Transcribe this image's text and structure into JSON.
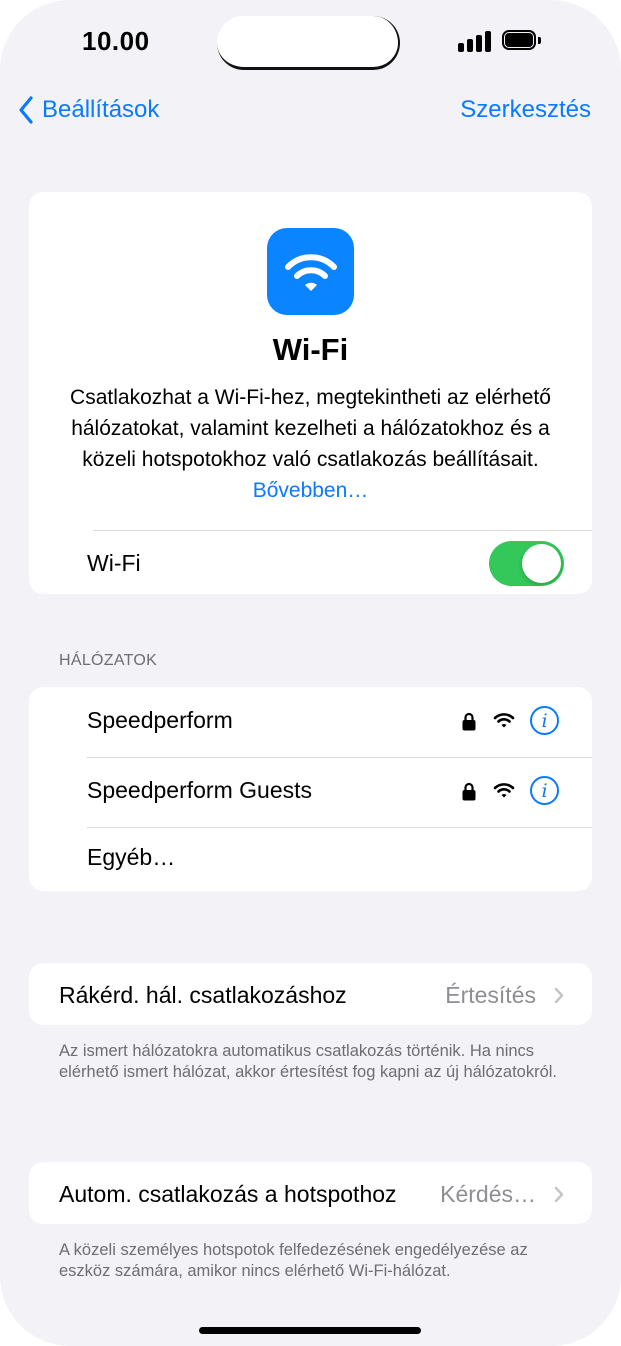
{
  "status_bar": {
    "time": "10.00"
  },
  "nav": {
    "back_label": "Beállítások",
    "edit_label": "Szerkesztés"
  },
  "hero": {
    "title": "Wi-Fi",
    "description": "Csatlakozhat a Wi-Fi-hez, megtekintheti az elérhető hálózatokat, valamint kezelheti a hálózatokhoz és a közeli hotspotokhoz való csatlakozás beállításait.",
    "link_label": "Bővebben…",
    "wifi_label": "Wi-Fi",
    "wifi_enabled": true
  },
  "networks": {
    "header": "HÁLÓZATOK",
    "items": [
      {
        "name": "Speedperform",
        "locked": true,
        "info_icon": "info-icon"
      },
      {
        "name": "Speedperform Guests",
        "locked": true,
        "info_icon": "info-icon"
      }
    ],
    "other_label": "Egyéb…"
  },
  "ask_join": {
    "label": "Rákérd. hál. csatlakozáshoz",
    "value": "Értesítés",
    "footnote": "Az ismert hálózatokra automatikus csatlakozás történik. Ha nincs elérhető ismert hálózat, akkor értesítést fog kapni az új hálózatokról."
  },
  "auto_hotspot": {
    "label": "Autom. csatlakozás a hotspothoz",
    "value": "Kérdés…",
    "footnote": "A közeli személyes hotspotok felfedezésének engedélyezése az eszköz számára, amikor nincs elérhető Wi-Fi-hálózat."
  },
  "colors": {
    "accent": "#0a7aff",
    "toggle_on": "#34c759",
    "icon_bg": "#0a84ff",
    "background": "#f2f2f7"
  }
}
